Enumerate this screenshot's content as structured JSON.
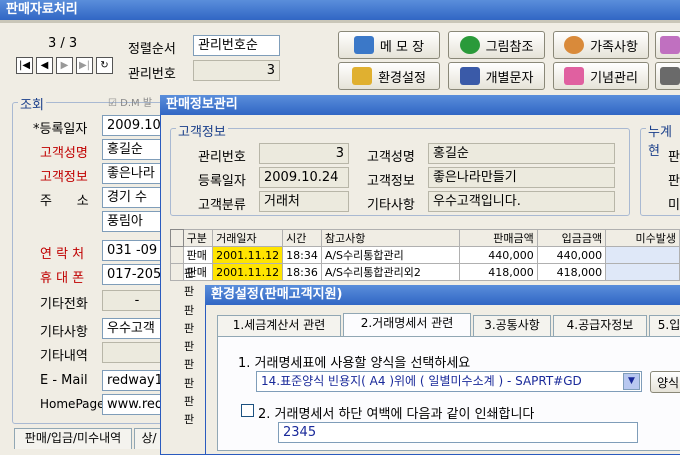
{
  "main": {
    "title": "판매자료처리",
    "counter": "3 / 3",
    "sort_label": "정렬순서",
    "sort_value": "관리번호순",
    "mgmt_label": "관리번호",
    "mgmt_value": "3",
    "nav_buttons": [
      "|◀",
      "◀",
      "▶",
      "▶|",
      "↻"
    ],
    "toolbar": [
      "메 모 장",
      "그림참조",
      "가족사항",
      "환경설정",
      "개별문자",
      "기념관리"
    ],
    "query_group": "조회",
    "dm_label": "D.M 발",
    "fields": [
      {
        "label": "*등록일자",
        "value": "2009.10"
      },
      {
        "label": "고객성명",
        "value": "홍길순"
      },
      {
        "label": "고객정보",
        "value": "좋은나라"
      },
      {
        "label": "주      소",
        "value": "경기 수"
      },
      {
        "label": "",
        "value": "풍림아"
      },
      {
        "label": "연 락 처",
        "value": "031 -09"
      },
      {
        "label": "휴 대 폰",
        "value": "017-205"
      },
      {
        "label": "기타전화",
        "value": "-"
      },
      {
        "label": "기타사항",
        "value": "우수고객"
      },
      {
        "label": "기타내역",
        "value": ""
      },
      {
        "label": "E - Mail",
        "value": "redway1"
      },
      {
        "label": "HomePage",
        "value": "www.red"
      }
    ],
    "bottom_tabs": [
      "판매/입금/미수내역",
      "상/"
    ]
  },
  "sales": {
    "title": "판매정보관리",
    "group": "고객정보",
    "group2": "누계현",
    "mgmt_label": "관리번호",
    "mgmt_value": "3",
    "name_label": "고객성명",
    "name_value": "홍길순",
    "reg_label": "등록일자",
    "reg_value": "2009.10.24",
    "info_label": "고객정보",
    "info_value": "좋은나라만들기",
    "class_label": "고객분류",
    "class_value": "거래처",
    "etc_label": "기타사항",
    "etc_value": "우수고객입니다.",
    "right_labels": [
      "판",
      "판",
      "미"
    ],
    "columns": [
      "구분",
      "거래일자",
      "시간",
      "참고사항",
      "판매금액",
      "입금금액",
      "미수발생"
    ],
    "rows": [
      [
        "판매",
        "2001.11.12",
        "18:34",
        "A/S수리통합관리",
        "440,000",
        "440,000",
        ""
      ],
      [
        "판매",
        "2001.11.12",
        "18:36",
        "A/S수리통합관리외2",
        "418,000",
        "418,000",
        ""
      ]
    ],
    "side_labels": [
      "판",
      "판",
      "판",
      "판",
      "판",
      "판",
      "판",
      "판",
      "판"
    ]
  },
  "env": {
    "title": "환경설정(판매고객지원)",
    "tabs": [
      "1.세금계산서 관련",
      "2.거래명세서 관련",
      "3.공통사항",
      "4.공급자정보",
      "5.입"
    ],
    "q1": "1. 거래명세표에 사용할 양식을 선택하세요",
    "q1_value": "14.표준양식 빈용지( A4 )위에 ( 일별미수소계 ) - SAPRT#GD",
    "q1_button": "양식",
    "q2": "2. 거래명세서 하단 여백에 다음과 같이 인쇄합니다",
    "q2_value": "2345"
  }
}
